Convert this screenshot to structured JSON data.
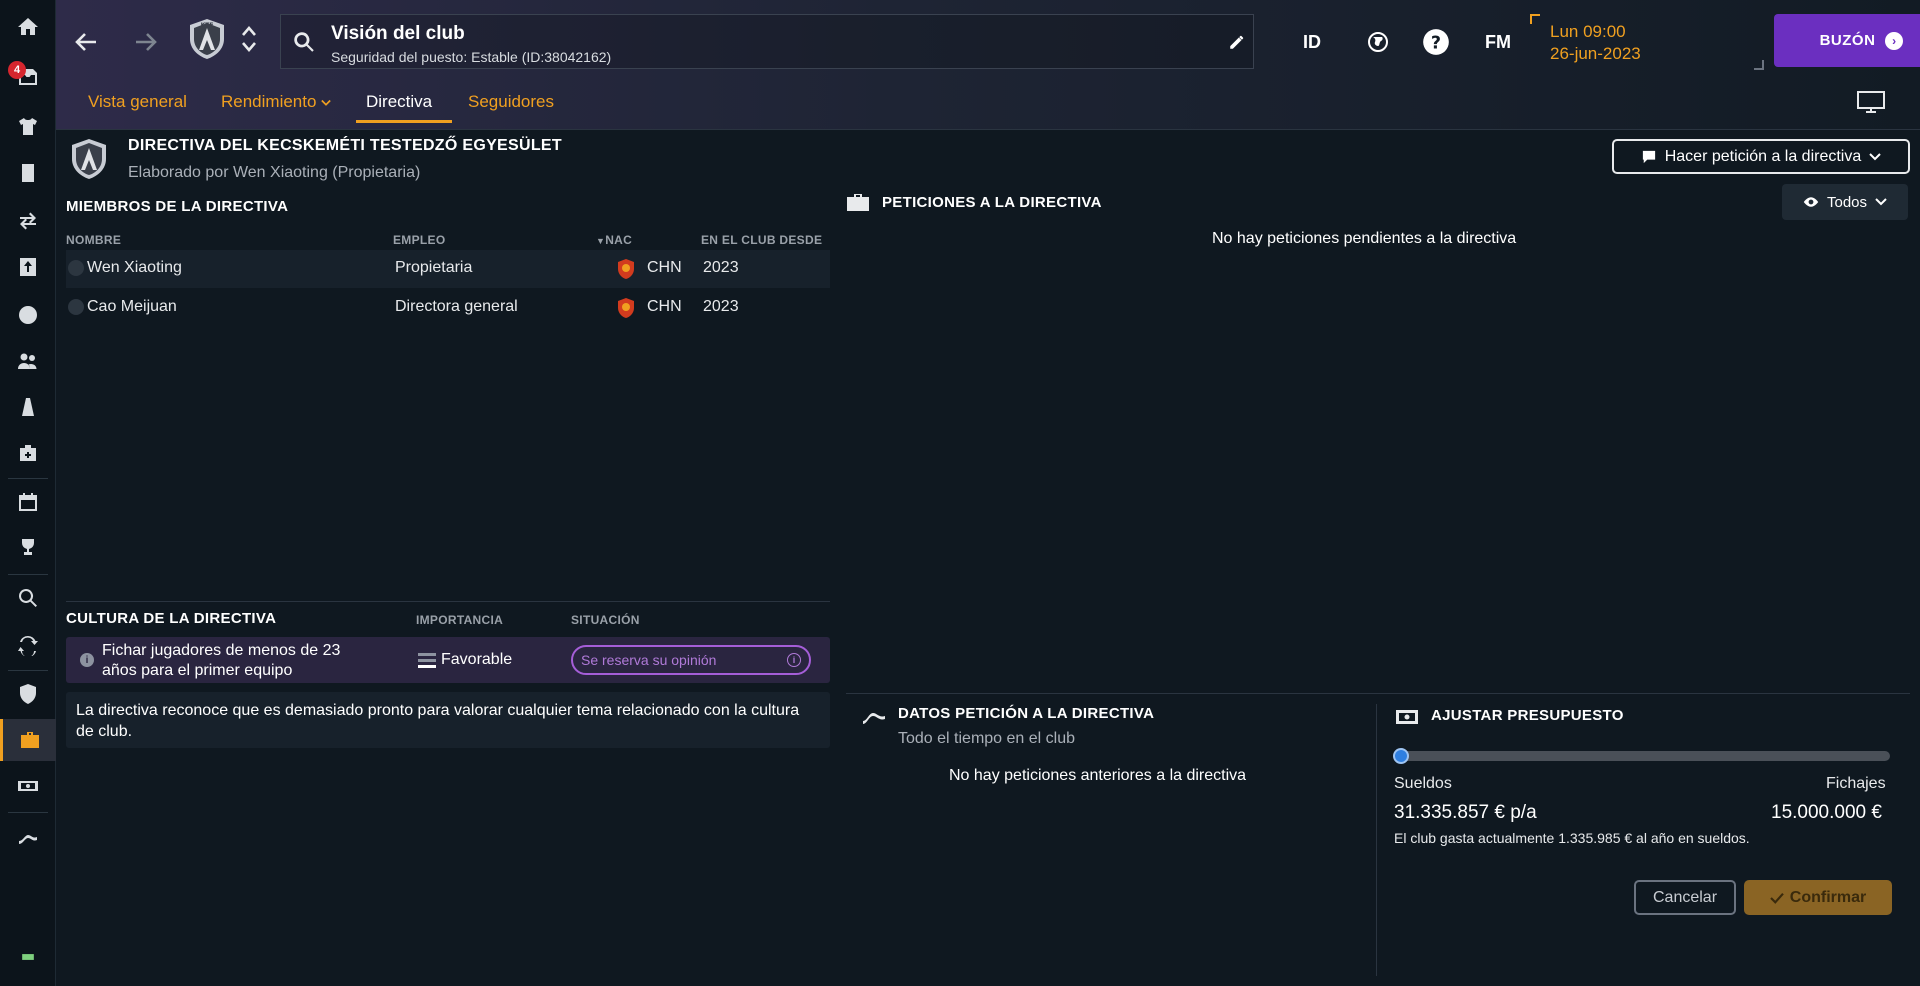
{
  "sidebar": {
    "inbox_badge": "4",
    "items": [
      {
        "name": "home-icon"
      },
      {
        "name": "inbox-icon"
      },
      {
        "name": "squad-icon"
      },
      {
        "name": "tactics-icon"
      },
      {
        "name": "transfers-icon"
      },
      {
        "name": "development-icon"
      },
      {
        "name": "scouting-icon"
      },
      {
        "name": "staff-icon"
      },
      {
        "name": "training-icon"
      },
      {
        "name": "medical-icon"
      },
      {
        "name": "schedule-icon"
      },
      {
        "name": "competitions-icon"
      },
      {
        "name": "search-icon"
      },
      {
        "name": "refresh-icon"
      },
      {
        "name": "club-icon"
      },
      {
        "name": "board-icon"
      },
      {
        "name": "finances-icon"
      },
      {
        "name": "stats-icon"
      }
    ]
  },
  "header": {
    "search_title": "Visión del club",
    "search_subtitle": "Seguridad del puesto: Estable (ID:38042162)",
    "id_label": "ID",
    "fm_label": "FM",
    "date_line1": "Lun 09:00",
    "date_line2": "26-jun-2023",
    "inbox_label": "BUZÓN",
    "inbox_arrow": "›"
  },
  "tabs": [
    {
      "label": "Vista general"
    },
    {
      "label": "Rendimiento"
    },
    {
      "label": "Directiva"
    },
    {
      "label": "Seguidores"
    }
  ],
  "board": {
    "title": "DIRECTIVA DEL KECSKEMÉTI TESTEDZŐ EGYESÜLET",
    "subtitle": "Elaborado por Wen Xiaoting (Propietaria)",
    "members_heading": "MIEMBROS DE LA DIRECTIVA",
    "columns": {
      "name": "NOMBRE",
      "role": "EMPLEO",
      "nat": "NAC",
      "since": "EN EL CLUB DESDE"
    },
    "members": [
      {
        "name": "Wen Xiaoting",
        "role": "Propietaria",
        "nat": "CHN",
        "since": "2023"
      },
      {
        "name": "Cao Meijuan",
        "role": "Directora general",
        "nat": "CHN",
        "since": "2023"
      }
    ]
  },
  "culture": {
    "heading": "CULTURA DE LA DIRECTIVA",
    "col_importance": "IMPORTANCIA",
    "col_situation": "SITUACIÓN",
    "item_text": "Fichar jugadores de menos de 23 años para el primer equipo",
    "importance": "Favorable",
    "situation": "Se reserva su opinión",
    "note": "La directiva reconoce que es demasiado pronto para valorar cualquier tema relacionado con la cultura de club."
  },
  "requests": {
    "make_request_label": "Hacer petición a la directiva",
    "heading": "PETICIONES A LA DIRECTIVA",
    "filter_label": "Todos",
    "empty_pending": "No hay peticiones pendientes a la directiva",
    "data_heading": "DATOS PETICIÓN A LA DIRECTIVA",
    "data_sub": "Todo el tiempo en el club",
    "empty_previous": "No hay peticiones anteriores a la directiva"
  },
  "budget": {
    "heading": "AJUSTAR PRESUPUESTO",
    "wages_label": "Sueldos",
    "transfers_label": "Fichajes",
    "wages_value": "31.335.857 € p/a",
    "transfers_value": "15.000.000 €",
    "note": "El club gasta actualmente 1.335.985 € al año en sueldos.",
    "slider_position": 0.0,
    "cancel_label": "Cancelar",
    "confirm_label": "Confirmar"
  },
  "colors": {
    "accent": "#f0a020",
    "inbox": "#6b2fc0",
    "situation": "#a55ed8"
  }
}
